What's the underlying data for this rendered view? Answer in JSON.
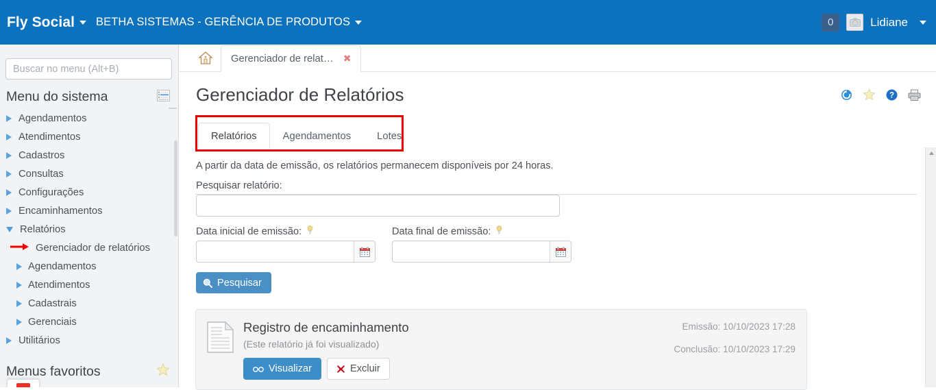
{
  "header": {
    "brand": "Fly Social",
    "organization": "BETHA SISTEMAS - GERÊNCIA DE PRODUTOS",
    "notification_count": "0",
    "user_name": "Lidiane",
    "accent_color": "#0d72bd"
  },
  "sidebar": {
    "search_placeholder": "Buscar no menu (Alt+B)",
    "search_value": "",
    "menu_title": "Menu do sistema",
    "favorites_title": "Menus favoritos",
    "items": [
      {
        "label": "Agendamentos",
        "level": 0,
        "expanded": false,
        "marked": false
      },
      {
        "label": "Atendimentos",
        "level": 0,
        "expanded": false,
        "marked": false
      },
      {
        "label": "Cadastros",
        "level": 0,
        "expanded": false,
        "marked": false
      },
      {
        "label": "Consultas",
        "level": 0,
        "expanded": false,
        "marked": false
      },
      {
        "label": "Configurações",
        "level": 0,
        "expanded": false,
        "marked": false
      },
      {
        "label": "Encaminhamentos",
        "level": 0,
        "expanded": false,
        "marked": false
      },
      {
        "label": "Relatórios",
        "level": 0,
        "expanded": true,
        "marked": false
      },
      {
        "label": "Gerenciador de relatórios",
        "level": 1,
        "expanded": false,
        "marked": true
      },
      {
        "label": "Agendamentos",
        "level": 1,
        "expanded": false,
        "marked": false
      },
      {
        "label": "Atendimentos",
        "level": 1,
        "expanded": false,
        "marked": false
      },
      {
        "label": "Cadastrais",
        "level": 1,
        "expanded": false,
        "marked": false
      },
      {
        "label": "Gerenciais",
        "level": 1,
        "expanded": false,
        "marked": false
      },
      {
        "label": "Utilitários",
        "level": 0,
        "expanded": false,
        "marked": false
      }
    ]
  },
  "tabs": {
    "open_tab_label": "Gerenciador de relat…",
    "close_glyph": "✖"
  },
  "main": {
    "page_title": "Gerenciador de Relatórios",
    "inner_tabs": [
      {
        "label": "Relatórios",
        "active": true
      },
      {
        "label": "Agendamentos",
        "active": false
      },
      {
        "label": "Lotes",
        "active": false
      }
    ],
    "notice": "A partir da data de emissão, os relatórios permanecem disponíveis por 24 horas.",
    "form": {
      "search_label": "Pesquisar relatório:",
      "search_value": "",
      "date_start_label": "Data inicial de emissão:",
      "date_start_value": "",
      "date_end_label": "Data final de emissão:",
      "date_end_value": "",
      "submit_label": "Pesquisar"
    },
    "results": [
      {
        "title": "Registro de encaminhamento",
        "subtitle": "(Este relatório já foi visualizado)",
        "view_label": "Visualizar",
        "delete_label": "Excluir",
        "emission": "Emissão: 10/10/2023 17:28",
        "conclusion": "Conclusão: 10/10/2023 17:29"
      }
    ]
  },
  "annotation": {
    "highlight_color": "#f20000"
  }
}
